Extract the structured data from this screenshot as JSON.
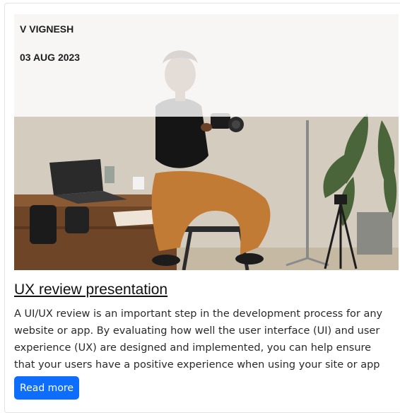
{
  "card": {
    "author": "V VIGNESH",
    "date": "03 AUG 2023",
    "image_icon": "photographer-photo",
    "title": "UX review presentation",
    "description": "A UI/UX review is an important step in the development process for any website or app. By evaluating how well the user interface (UI) and user experience (UX) are designed and implemented, you can help ensure that your users have a positive experience when using your site or app",
    "button_label": "Read more",
    "button_color": "#0d6efd"
  }
}
